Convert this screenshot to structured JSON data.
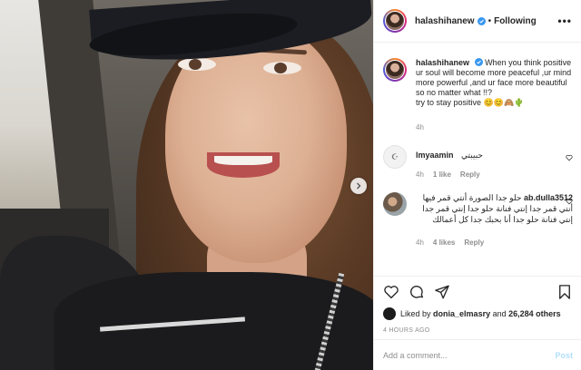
{
  "post": {
    "username": "halashihanew",
    "verified": true,
    "follow_separator": "•",
    "follow_label": "Following",
    "more_label": "•••"
  },
  "caption": {
    "username": "halashihanew",
    "text": "When you think positive ur soul will become more peaceful ,ur mind more powerful ,and ur face more beautiful so no matter what !!?",
    "text2": "try to stay positive 😊😊🙈🌵",
    "time": "4h"
  },
  "comments": [
    {
      "username": "lmyaamin",
      "text": "حبيبتي",
      "time": "4h",
      "likes": "1 like",
      "reply": "Reply"
    },
    {
      "username": "ab.dulla3512",
      "text": "حلو جدا الصورة أنتي قمر فيها أنتي قمر جدا إنتي فنانة حلو جدا إنتي قمر جدا إنتي فنانة حلو جدا أنا بحبك جدا كل أعمالك",
      "time": "4h",
      "likes": "4 likes",
      "reply": "Reply"
    }
  ],
  "likes": {
    "prefix": "Liked by",
    "first_user": "donia_elmasry",
    "and": "and",
    "others": "26,284 others"
  },
  "timestamp": "4 HOURS AGO",
  "add_comment": {
    "placeholder": "Add a comment...",
    "post_label": "Post"
  },
  "colors": {
    "verified_blue": "#3897f0",
    "post_button": "#b2dffc",
    "secondary_text": "#8e8e8e"
  }
}
